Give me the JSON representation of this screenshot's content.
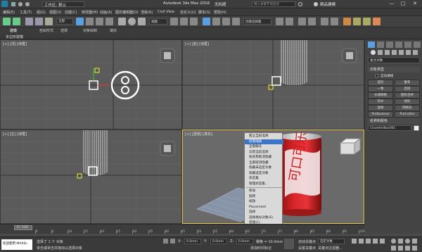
{
  "titlebar": {
    "workspace": "工作区: 默认",
    "app_title": "Autodesk 3ds Max 2016",
    "doc_title": "无标题",
    "search_placeholder": "键入关键字或短语",
    "user": "精品建模",
    "minimize": "—",
    "maximize": "□",
    "close": "✕"
  },
  "menus": [
    "编辑(E)",
    "工具(T)",
    "组(G)",
    "视图(V)",
    "创建(C)",
    "修改器(M)",
    "动画(A)",
    "图形编辑器(D)",
    "渲染(R)",
    "Civil View",
    "自定义(U)",
    "脚本(S)",
    "帮助(H)"
  ],
  "ribbon": {
    "tabs": [
      "建模",
      "自由形式",
      "选择",
      "对象绘制",
      "填充"
    ],
    "sub_label": "多边形建模"
  },
  "toolbar": {
    "view_dropdown": "视图",
    "selection_set": "创建选择集"
  },
  "viewports": {
    "top": "[+] [顶] [线框]",
    "front": "[+] [前] [线框]",
    "left": "[+] [左] [线框]",
    "persp": "[+] [透视] [真实]"
  },
  "cmdpanel": {
    "dropdown": "复合对象",
    "section_object_type": "对象类型",
    "autogrid": "自动栅格",
    "buttons": [
      "变形",
      "散布",
      "一致",
      "连接",
      "水滴网格",
      "图形合并",
      "布尔",
      "地形",
      "放样",
      "网格化",
      "ProBoolean",
      "ProCutter"
    ],
    "section_name": "名称和颜色",
    "object_name": "ChamferBox001"
  },
  "context_menu": {
    "items": [
      {
        "label": "孤立当前选择",
        "selected": false
      },
      {
        "label": "结束隔离",
        "selected": true
      },
      {
        "label": "全部解冻",
        "selected": false
      },
      {
        "label": "冻结当前选择",
        "selected": false
      },
      {
        "label": "按名称取消隐藏",
        "selected": false
      },
      {
        "label": "全部取消隐藏",
        "selected": false
      },
      {
        "label": "隐藏未选定对象",
        "selected": false
      },
      {
        "label": "隐藏选定对象",
        "selected": false
      },
      {
        "label": "状态集",
        "selected": false
      },
      {
        "label": "管理状态集...",
        "selected": false
      },
      {
        "label": "移动",
        "selected": false
      },
      {
        "label": "旋转",
        "selected": false
      },
      {
        "label": "缩放",
        "selected": false
      },
      {
        "label": "Placement",
        "selected": false
      },
      {
        "label": "选择",
        "selected": false
      },
      {
        "label": "选择类似对象(S)",
        "selected": false
      },
      {
        "label": "克隆(C)",
        "selected": false
      },
      {
        "label": "对象属性(P)...",
        "selected": false
      },
      {
        "label": "曲线编辑器...",
        "selected": false
      },
      {
        "label": "摄影表...",
        "selected": false
      },
      {
        "label": "关联参数...",
        "selected": false
      },
      {
        "label": "转换为:",
        "selected": false
      }
    ]
  },
  "timeline": {
    "frame": "0 / 100",
    "ticks": [
      "0",
      "5",
      "10",
      "15",
      "20",
      "25",
      "30",
      "35",
      "40",
      "45",
      "50",
      "55",
      "60",
      "65",
      "70",
      "75",
      "80",
      "85",
      "90",
      "95",
      "100"
    ]
  },
  "status": {
    "maxscript": "欢迎使用 MAXSc",
    "selected_msg": "选择了 1 个 对象",
    "hint": "单击或单击并拖动以选择对象",
    "x_label": "X:",
    "x_val": "0.0mm",
    "y_label": "Y:",
    "y_val": "0.0mm",
    "z_label": "Z:",
    "z_val": "0.0mm",
    "grid": "栅格 = 10.0mm",
    "autokey": "自动关键点",
    "setkey": "设置关键点",
    "selected_obj": "选定对象",
    "keyfilter": "关键点过滤器...",
    "add_time_tag": "添加时间标记"
  },
  "accent": "#3c75c8"
}
